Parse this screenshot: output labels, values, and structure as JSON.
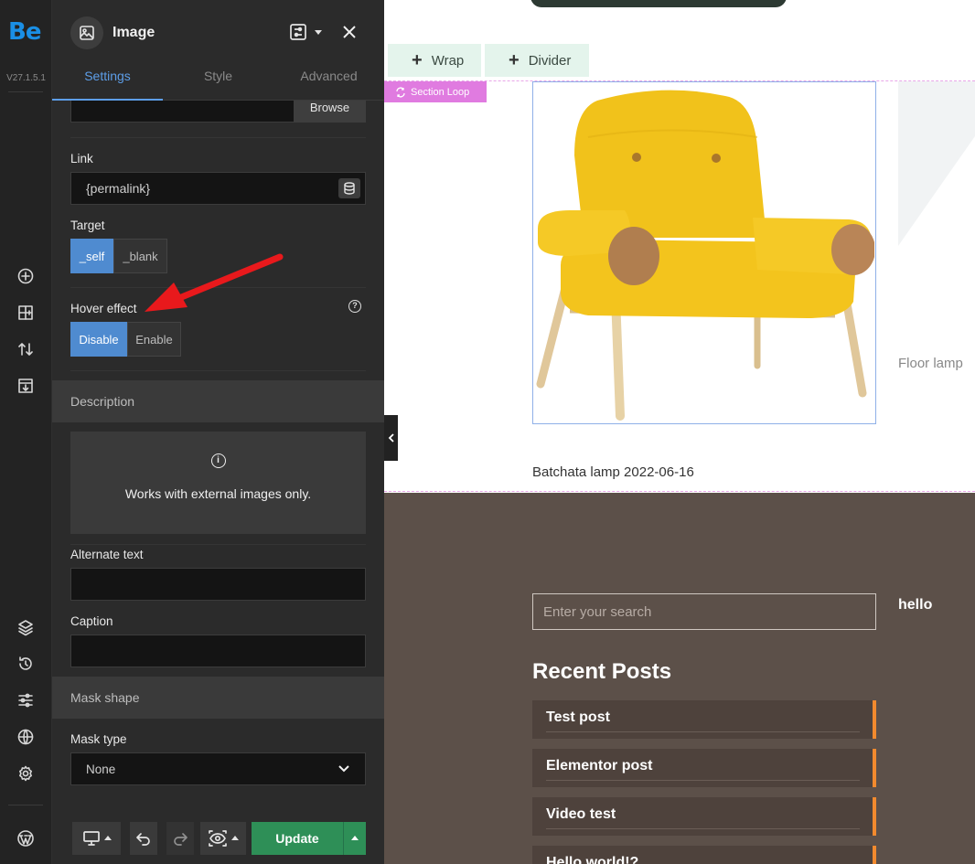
{
  "rail": {
    "logo": "Be",
    "version": "V27.1.5.1",
    "icons": [
      "add-icon",
      "layout-icon",
      "sort-icon",
      "import-icon",
      "layers-icon",
      "history-icon",
      "sliders-icon",
      "globe-icon",
      "gear-icon",
      "wordpress-icon"
    ]
  },
  "panel": {
    "title": "Image",
    "tabs": [
      "Settings",
      "Style",
      "Advanced"
    ],
    "active_tab": "Settings",
    "browse_label": "Browse",
    "link_label": "Link",
    "link_value": "{permalink}",
    "target_label": "Target",
    "target_options": [
      "_self",
      "_blank"
    ],
    "target_selected": "_self",
    "hover_label": "Hover effect",
    "hover_options": [
      "Disable",
      "Enable"
    ],
    "hover_selected": "Disable",
    "description_section": "Description",
    "info_text": "Works with external images only.",
    "alt_label": "Alternate text",
    "alt_value": "",
    "caption_label": "Caption",
    "caption_value": "",
    "mask_section": "Mask shape",
    "mask_type_label": "Mask type",
    "mask_type_value": "None",
    "update_label": "Update"
  },
  "canvas": {
    "add_buttons": [
      "Wrap",
      "Divider"
    ],
    "loop_badge": "Section Loop",
    "card_title": "Batchata lamp 2022-06-16",
    "ghost_title": "Floor lamp",
    "search_placeholder": "Enter your search",
    "hello": "hello",
    "recent_posts_title": "Recent Posts",
    "posts": [
      "Test post",
      "Elementor post",
      "Video test",
      "Hello world!?"
    ]
  },
  "colors": {
    "accent_blue": "#4f8bd0",
    "update_green": "#2e8f57",
    "loop_pink": "#e07be0",
    "post_orange": "#f28a2e",
    "annotation_red": "#e8191c"
  }
}
